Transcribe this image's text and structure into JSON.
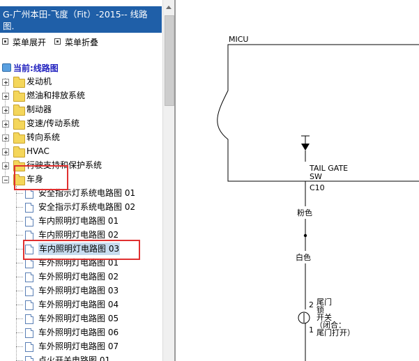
{
  "window": {
    "title": "G-广州本田-飞度（Fit）-2015-- 线路图."
  },
  "menu": {
    "expand_label": "菜单展开",
    "collapse_label": "菜单折叠"
  },
  "current": {
    "label": "当前:线路图"
  },
  "tree": {
    "folders": [
      {
        "label": "发动机",
        "expanded": false
      },
      {
        "label": "燃油和排放系统",
        "expanded": false
      },
      {
        "label": "制动器",
        "expanded": false
      },
      {
        "label": "变速/传动系统",
        "expanded": false
      },
      {
        "label": "转向系统",
        "expanded": false
      },
      {
        "label": "HVAC",
        "expanded": false
      },
      {
        "label": "行驶支持和保护系统",
        "expanded": false
      },
      {
        "label": "车身",
        "expanded": true
      }
    ],
    "body_items": [
      {
        "label": "安全指示灯系统电路图 01"
      },
      {
        "label": "安全指示灯系统电路图 02"
      },
      {
        "label": "车内照明灯电路图 01"
      },
      {
        "label": "车内照明灯电路图 02"
      },
      {
        "label": "车内照明灯电路图 03",
        "selected": true
      },
      {
        "label": "车外照明灯电路图 01"
      },
      {
        "label": "车外照明灯电路图 02"
      },
      {
        "label": "车外照明灯电路图 03"
      },
      {
        "label": "车外照明灯电路图 04"
      },
      {
        "label": "车外照明灯电路图 05"
      },
      {
        "label": "车外照明灯电路图 06"
      },
      {
        "label": "车外照明灯电路图 07"
      },
      {
        "label": "点火开关电路图 01"
      }
    ]
  },
  "diagram": {
    "module_label": "MICU",
    "connector_name_line1": "TAIL GATE",
    "connector_name_line2": "SW",
    "connector_code": "C10",
    "wire_color_1": "粉色",
    "wire_color_2": "白色",
    "pin_top": "2",
    "pin_bottom": "1",
    "switch_desc_1": "尾门",
    "switch_desc_2": "锁",
    "switch_desc_3": "开关",
    "switch_desc_4": "（闭合：",
    "switch_desc_5": "尾门打开）"
  },
  "colors": {
    "title_bar": "#1f5fa8",
    "current_label": "#1e1ebe",
    "highlight_box": "#e03030",
    "selection": "#c8dcf0"
  }
}
